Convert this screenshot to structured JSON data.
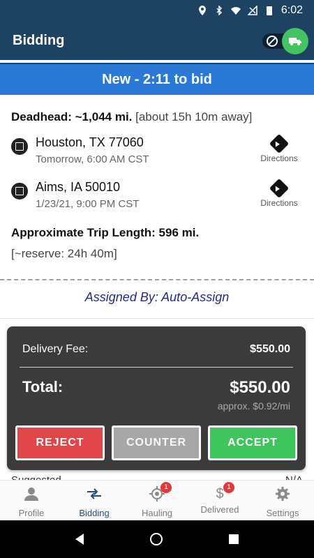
{
  "status": {
    "time": "6:02"
  },
  "appbar": {
    "title": "Bidding"
  },
  "countdown": {
    "text": "New - 2:11 to bid"
  },
  "deadhead": {
    "label": "Deadhead: ~1,044 mi.",
    "note": "[about 15h 10m away]"
  },
  "stops": [
    {
      "city": "Houston, TX 77060",
      "time": "Tomorrow, 6:00 AM CST",
      "directions": "Directions"
    },
    {
      "city": "Aims, IA 50010",
      "time": "1/23/21, 9:00 PM CST",
      "directions": "Directions"
    }
  ],
  "trip": {
    "length": "Approximate Trip Length: 596 mi.",
    "reserve": "[~reserve: 24h 40m]"
  },
  "assigned": {
    "text": "Assigned By: Auto-Assign"
  },
  "fee": {
    "delivery_label": "Delivery Fee:",
    "delivery_amount": "$550.00",
    "total_label": "Total:",
    "total_amount": "$550.00",
    "approx": "approx. $0.92/mi"
  },
  "buttons": {
    "reject": "REJECT",
    "counter": "COUNTER",
    "accept": "ACCEPT"
  },
  "peek": {
    "left": "Suggested",
    "right": "N/A"
  },
  "nav": [
    {
      "label": "Profile",
      "icon": "person-icon"
    },
    {
      "label": "Bidding",
      "icon": "swap-icon"
    },
    {
      "label": "Hauling",
      "icon": "target-icon",
      "badge": "1"
    },
    {
      "label": "Delivered",
      "icon": "dollar-icon",
      "badge": "1"
    },
    {
      "label": "Settings",
      "icon": "gear-icon"
    }
  ],
  "colors": {
    "appbar": "#1e4261",
    "countdown": "#2a79d7",
    "reject": "#df4549",
    "counter": "#a7a7a7",
    "accept": "#3ec55c"
  }
}
